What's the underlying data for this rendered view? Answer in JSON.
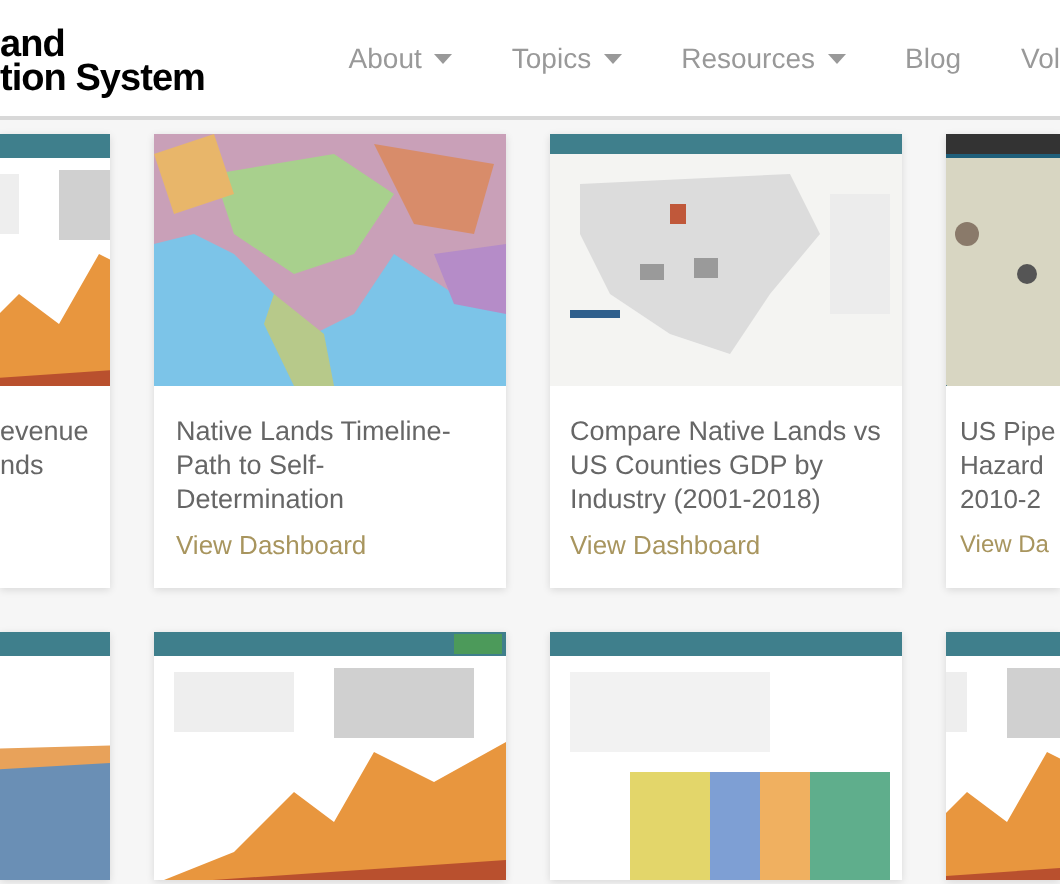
{
  "header": {
    "logo_lines": [
      "and",
      "tion System"
    ],
    "nav": [
      {
        "label": "About",
        "dropdown": true
      },
      {
        "label": "Topics",
        "dropdown": true
      },
      {
        "label": "Resources",
        "dropdown": true
      },
      {
        "label": "Blog",
        "dropdown": false
      },
      {
        "label": "Vol",
        "dropdown": false
      }
    ]
  },
  "card_rows": [
    {
      "cards": [
        {
          "picture": {
            "kind": "picture"
          },
          "title_lines": [
            "evenue",
            "nds"
          ]
        },
        {
          "picture": {
            "kind": "picture"
          },
          "title_lines": [
            "Native Lands Timeline-",
            "Path to Self-",
            "Determination"
          ],
          "link": "View Dashboard"
        },
        {
          "picture": {
            "kind": "picture"
          },
          "title_lines": [
            "Compare Native Lands vs",
            "US Counties GDP by",
            "Industry (2001-2018)"
          ],
          "link": "View Dashboard"
        },
        {
          "picture": {
            "kind": "picture"
          },
          "title_lines": [
            "US Pipe",
            "Hazard",
            "2010-2"
          ],
          "link": "View Da"
        }
      ]
    },
    {
      "cards": [
        {
          "picture": {
            "kind": "picture"
          }
        },
        {
          "picture": {
            "kind": "picture"
          }
        },
        {
          "picture": {
            "kind": "picture"
          }
        },
        {
          "picture": {
            "kind": "picture"
          }
        }
      ]
    }
  ]
}
